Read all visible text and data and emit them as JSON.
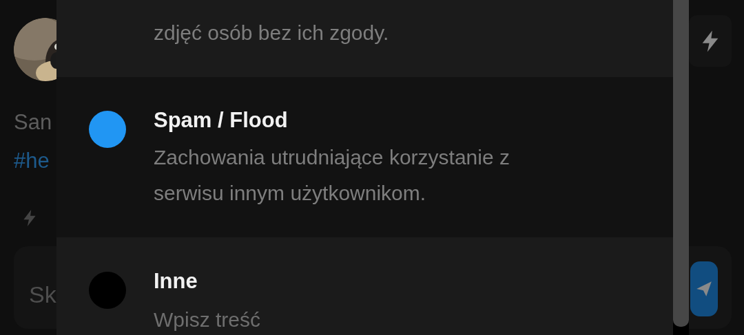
{
  "background": {
    "author_excerpt": "San",
    "hashtag_excerpt": "#he",
    "comment_placeholder": "Sk"
  },
  "report_options": [
    {
      "kind": "text",
      "description_lines": [
        "zdjęć osób bez ich zgody."
      ]
    },
    {
      "kind": "radio",
      "title": "Spam / Flood",
      "selected": true,
      "description_lines": [
        "Zachowania utrudniające korzystanie z",
        "serwisu innym użytkownikom."
      ]
    },
    {
      "kind": "input",
      "title": "Inne",
      "selected": false,
      "placeholder": "Wpisz treść"
    }
  ]
}
